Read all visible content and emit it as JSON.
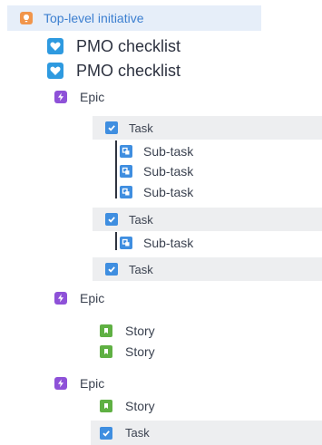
{
  "colors": {
    "initiative": "#f1954b",
    "pmo": "#2e9ae0",
    "epic": "#8e51d8",
    "task": "#3f8ee0",
    "story": "#5fb043",
    "selected_row": "#e6eef9",
    "highlight_row": "#edeef0",
    "initiative_text": "#3c7fd0"
  },
  "tree": {
    "initiative": {
      "label": "Top-level initiative",
      "icon": "initiative-icon"
    },
    "pmo_items": [
      {
        "label": "PMO checklist",
        "icon": "heart-icon"
      },
      {
        "label": "PMO checklist",
        "icon": "heart-icon"
      }
    ],
    "epics": [
      {
        "label": "Epic",
        "icon": "lightning-icon",
        "children": [
          {
            "type": "Task",
            "label": "Task",
            "subtasks": [
              "Sub-task",
              "Sub-task",
              "Sub-task"
            ]
          },
          {
            "type": "Task",
            "label": "Task",
            "subtasks": [
              "Sub-task"
            ]
          },
          {
            "type": "Task",
            "label": "Task",
            "subtasks": []
          }
        ]
      },
      {
        "label": "Epic",
        "icon": "lightning-icon",
        "children": [
          {
            "type": "Story",
            "label": "Story"
          },
          {
            "type": "Story",
            "label": "Story"
          }
        ]
      },
      {
        "label": "Epic",
        "icon": "lightning-icon",
        "children": [
          {
            "type": "Story",
            "label": "Story"
          },
          {
            "type": "Task",
            "label": "Task"
          }
        ]
      }
    ]
  }
}
